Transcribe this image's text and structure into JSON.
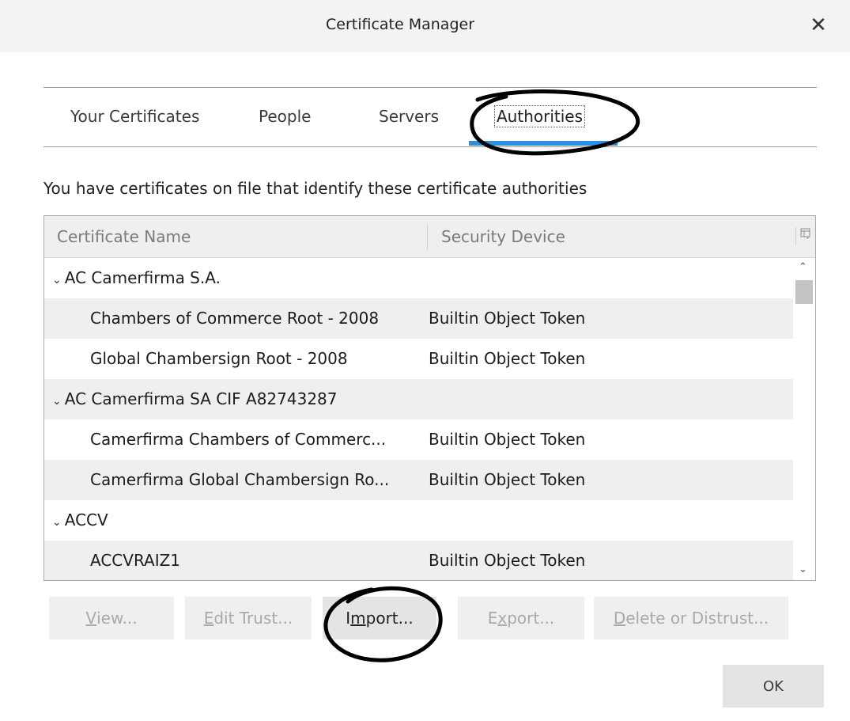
{
  "window": {
    "title": "Certificate Manager",
    "close_glyph": "✕"
  },
  "tabs": [
    {
      "label": "Your Certificates"
    },
    {
      "label": "People"
    },
    {
      "label": "Servers"
    },
    {
      "label": "Authorities",
      "selected": true
    }
  ],
  "description": "You have certificates on file that identify these certificate authorities",
  "table": {
    "columns": [
      "Certificate Name",
      "Security Device"
    ],
    "column_picker_icon": "column-picker-icon",
    "rows": [
      {
        "name": "AC Camerfirma S.A.",
        "device": "",
        "group": true,
        "expanded": true
      },
      {
        "name": "Chambers of Commerce Root - 2008",
        "device": "Builtin Object Token",
        "group": false
      },
      {
        "name": "Global Chambersign Root - 2008",
        "device": "Builtin Object Token",
        "group": false
      },
      {
        "name": "AC Camerfirma SA CIF A82743287",
        "device": "",
        "group": true,
        "expanded": true
      },
      {
        "name": "Camerfirma Chambers of Commerc...",
        "device": "Builtin Object Token",
        "group": false
      },
      {
        "name": "Camerfirma Global Chambersign Ro...",
        "device": "Builtin Object Token",
        "group": false
      },
      {
        "name": "ACCV",
        "device": "",
        "group": true,
        "expanded": true
      },
      {
        "name": "ACCVRAIZ1",
        "device": "Builtin Object Token",
        "group": false
      }
    ]
  },
  "buttons": {
    "view": "View...",
    "edit_trust": "Edit Trust...",
    "import": "Import...",
    "export": "Export...",
    "delete": "Delete or Distrust...",
    "ok": "OK"
  },
  "annotations": {
    "color": "#000000",
    "shape": "hand-drawn ellipse",
    "targets": [
      "Authorities tab",
      "Import button"
    ]
  }
}
